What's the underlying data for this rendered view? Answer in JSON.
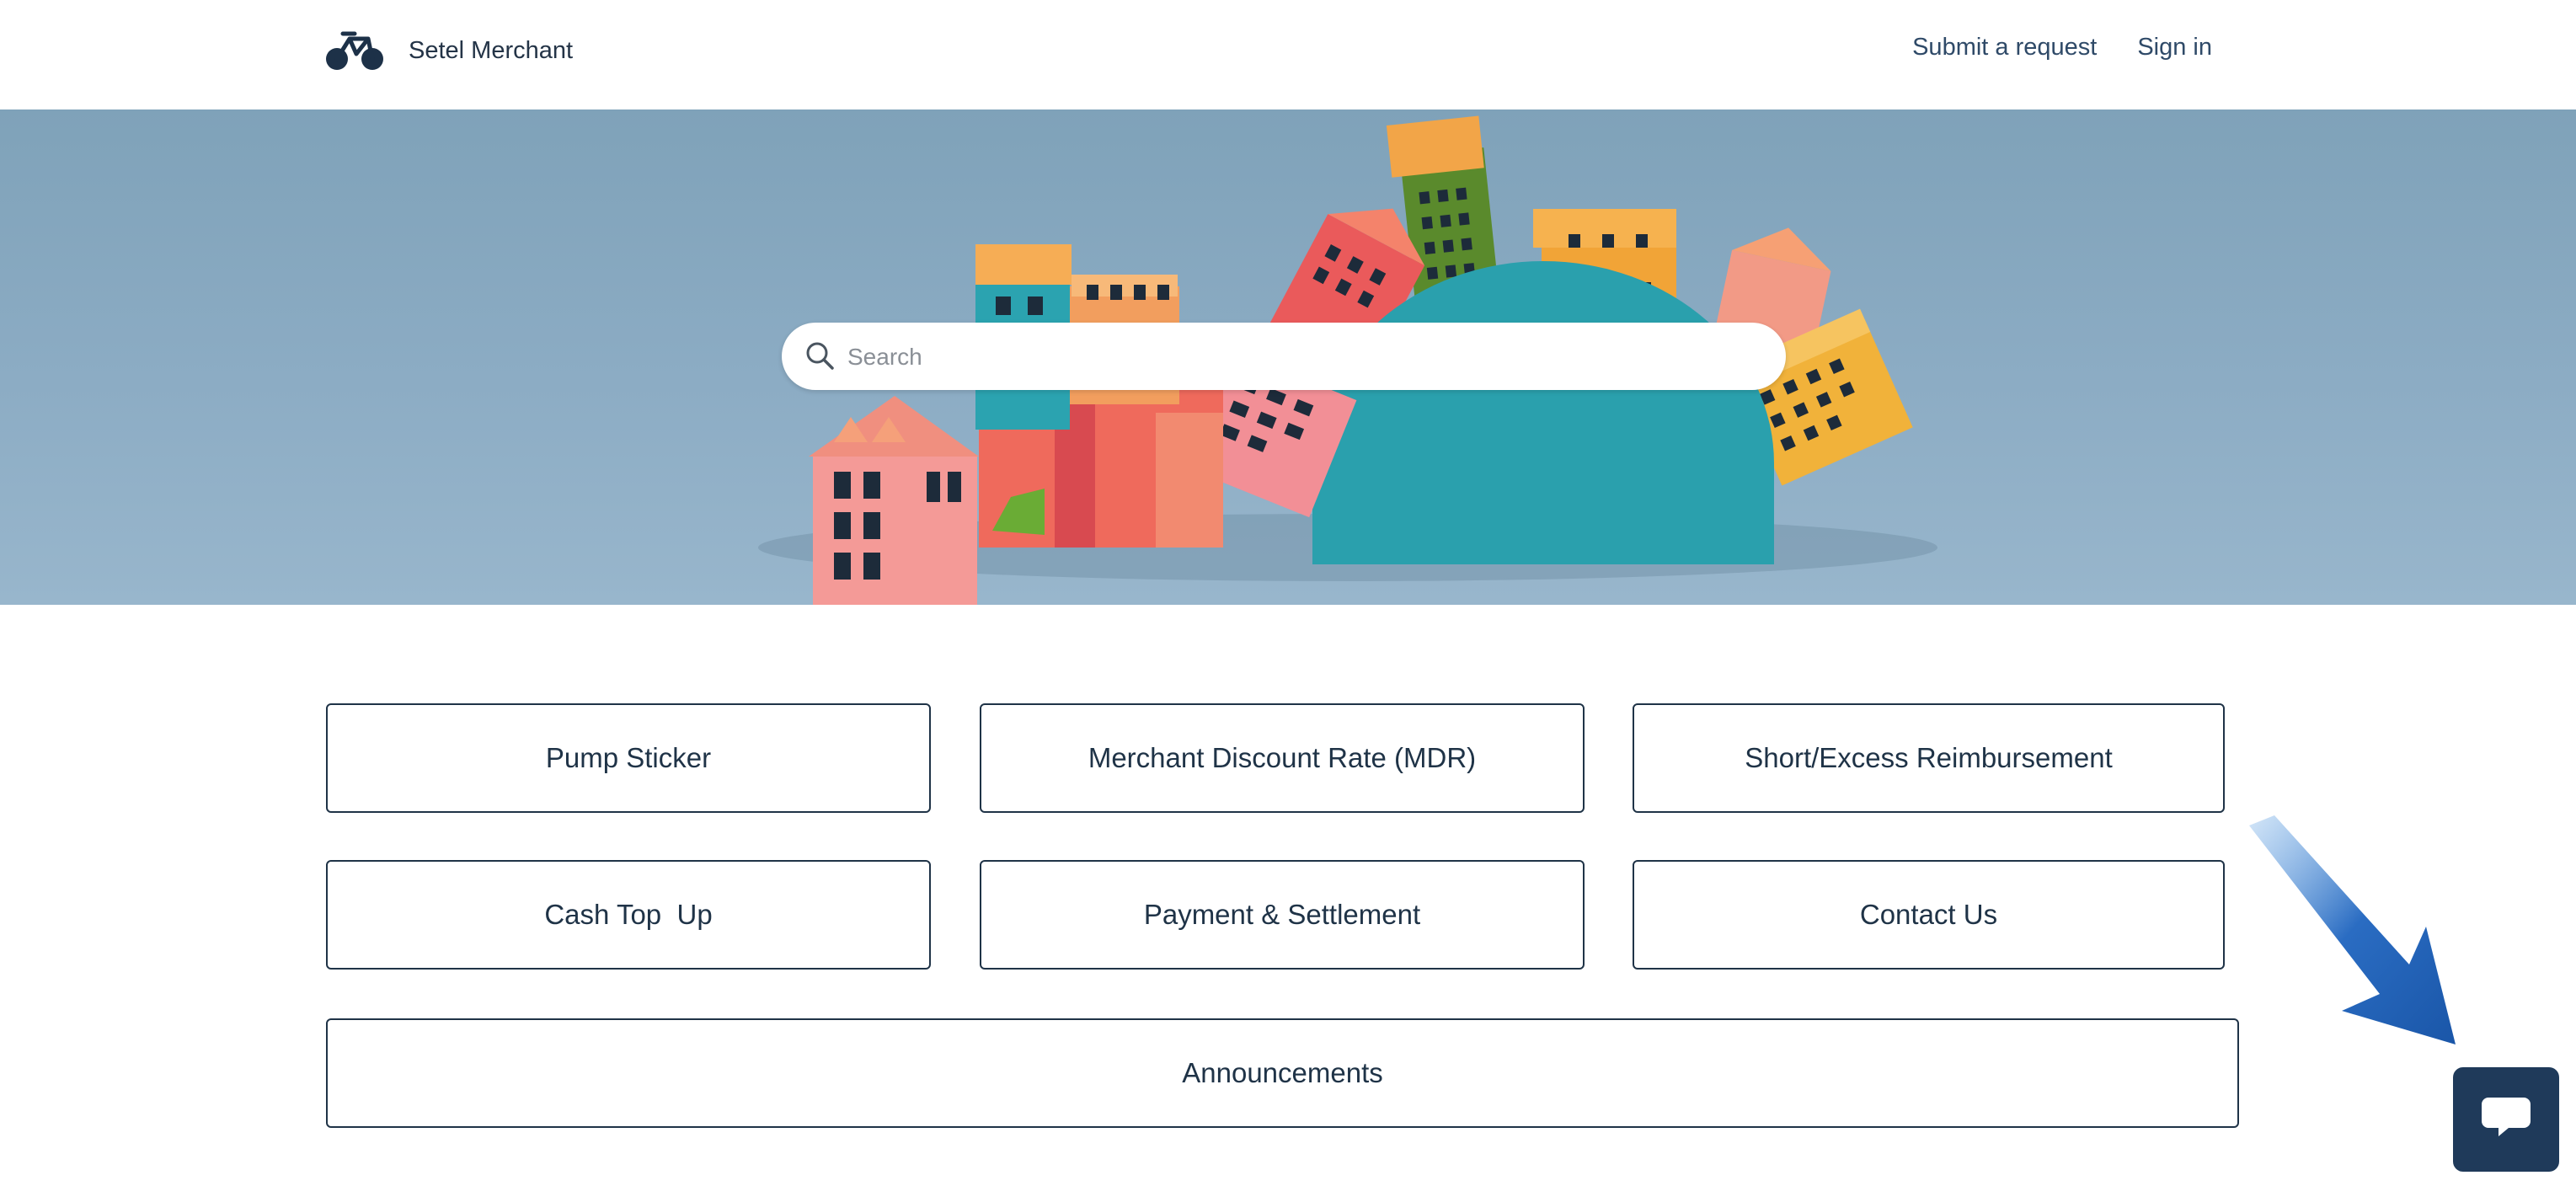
{
  "header": {
    "brand_name": "Setel Merchant",
    "logo_icon": "bicycle-icon",
    "nav": {
      "submit_request": "Submit a request",
      "sign_in": "Sign in"
    }
  },
  "hero": {
    "search": {
      "placeholder": "Search",
      "value": "",
      "icon": "search-icon"
    }
  },
  "categories": {
    "pump_sticker": "Pump Sticker",
    "mdr": "Merchant Discount Rate (MDR)",
    "short_excess": "Short/Excess Reimbursement",
    "cash_top_up": "Cash Top  Up",
    "payment_settlement": "Payment & Settlement",
    "contact_us": "Contact Us",
    "announcements": "Announcements"
  },
  "chat_widget": {
    "icon": "chat-bubble-icon"
  },
  "colors": {
    "text_dark": "#1f3347",
    "nav_link": "#2f4a68",
    "hero_sky": "#8cacc4",
    "chat_button": "#1f3a5a",
    "arrow": "#2a6cc2"
  }
}
